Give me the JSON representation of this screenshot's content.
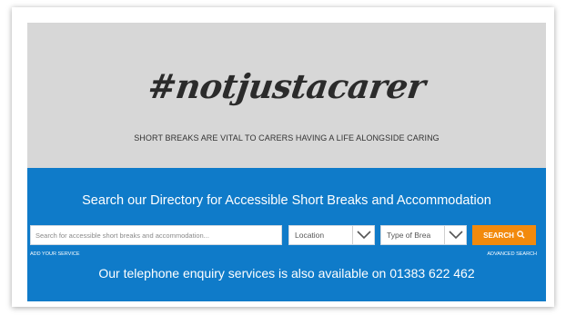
{
  "hero": {
    "hashtag": "#notjustacarer",
    "tagline": "SHORT BREAKS ARE VITAL TO CARERS HAVING A LIFE ALONGSIDE CARING"
  },
  "search": {
    "heading": "Search our Directory for Accessible Short Breaks and Accommodation",
    "placeholder": "Search for accessible short breaks and accommodation...",
    "location_value": "Location",
    "type_value": "Type of Brea",
    "button_label": "SEARCH",
    "button_icon": "search-icon",
    "add_service_label": "ADD YOUR SERVICE",
    "advanced_label": "ADVANCED SEARCH",
    "phone_text": "Our telephone enquiry services is also available on 01383 622 462"
  },
  "colors": {
    "hero_bg": "#d7d7d7",
    "panel_bg": "#0f7bc9",
    "accent": "#f28a0d"
  }
}
